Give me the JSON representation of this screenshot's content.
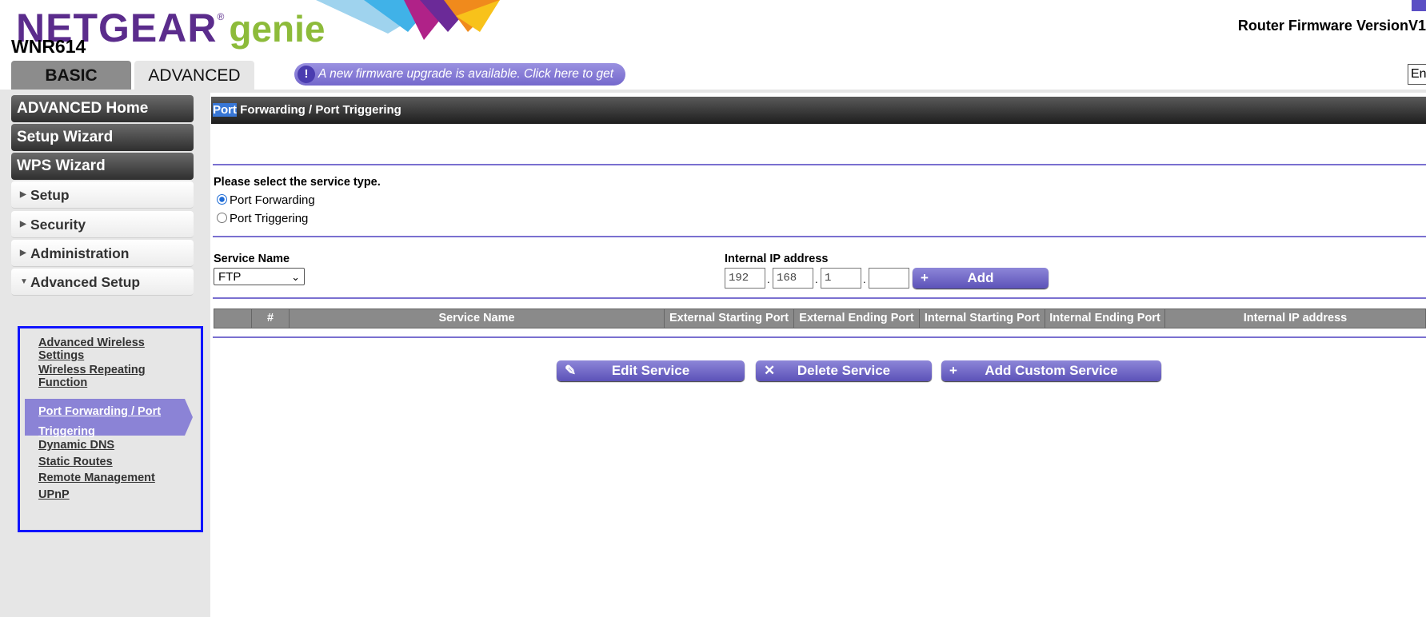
{
  "header": {
    "logo_brand": "NETGEAR",
    "logo_reg": "®",
    "logo_product": "genie",
    "model": "WNR614",
    "firmware_version_label": "Router Firmware VersionV1",
    "tabs": [
      {
        "label": "BASIC"
      },
      {
        "label": "ADVANCED"
      }
    ],
    "firmware_banner": "A new firmware upgrade is available. Click here to get it.",
    "language_box": "En"
  },
  "sidebar": {
    "buttons": [
      {
        "label": "ADVANCED Home"
      },
      {
        "label": "Setup Wizard"
      },
      {
        "label": "WPS Wizard"
      }
    ],
    "menus": [
      {
        "label": "Setup",
        "arrow": "▶"
      },
      {
        "label": "Security",
        "arrow": "▶"
      },
      {
        "label": "Administration",
        "arrow": "▶"
      },
      {
        "label": "Advanced Setup",
        "arrow": "▼"
      }
    ],
    "advanced_setup_items": [
      {
        "label": "Advanced Wireless Settings"
      },
      {
        "label": "Wireless Repeating Function"
      },
      {
        "label": "Port Forwarding / Port Triggering",
        "active": true
      },
      {
        "label": "Dynamic DNS"
      },
      {
        "label": "Static Routes"
      },
      {
        "label": "Remote Management"
      },
      {
        "label": "UPnP"
      }
    ]
  },
  "main": {
    "title_highlight": "Port",
    "title_rest": " Forwarding / Port Triggering",
    "service_type_prompt": "Please select the service type.",
    "service_type_options": [
      {
        "label": "Port Forwarding",
        "selected": true
      },
      {
        "label": "Port Triggering",
        "selected": false
      }
    ],
    "service_name_label": "Service Name",
    "service_name_value": "FTP",
    "internal_ip_label": "Internal IP address",
    "ip_octets": [
      "192",
      "168",
      "1",
      ""
    ],
    "ip_separator": ".",
    "add_button": "Add",
    "table_headers": [
      "",
      "#",
      "Service Name",
      "External Starting Port",
      "External Ending Port",
      "Internal Starting Port",
      "Internal Ending Port",
      "Internal IP address"
    ],
    "buttons": {
      "edit": "Edit Service",
      "delete": "Delete Service",
      "add_custom": "Add Custom Service"
    }
  },
  "colors": {
    "brand_purple": "#5b2c8c",
    "genie_green": "#8dbb3a",
    "accent_button": "#7468cc",
    "sidebar_highlight_border": "#1014ff"
  },
  "icons": {
    "firmware_alert": "exclamation-icon",
    "add": "plus-icon",
    "edit": "pencil-icon",
    "delete": "x-icon",
    "menu_collapsed": "triangle-right-icon",
    "menu_expanded": "triangle-down-icon"
  }
}
